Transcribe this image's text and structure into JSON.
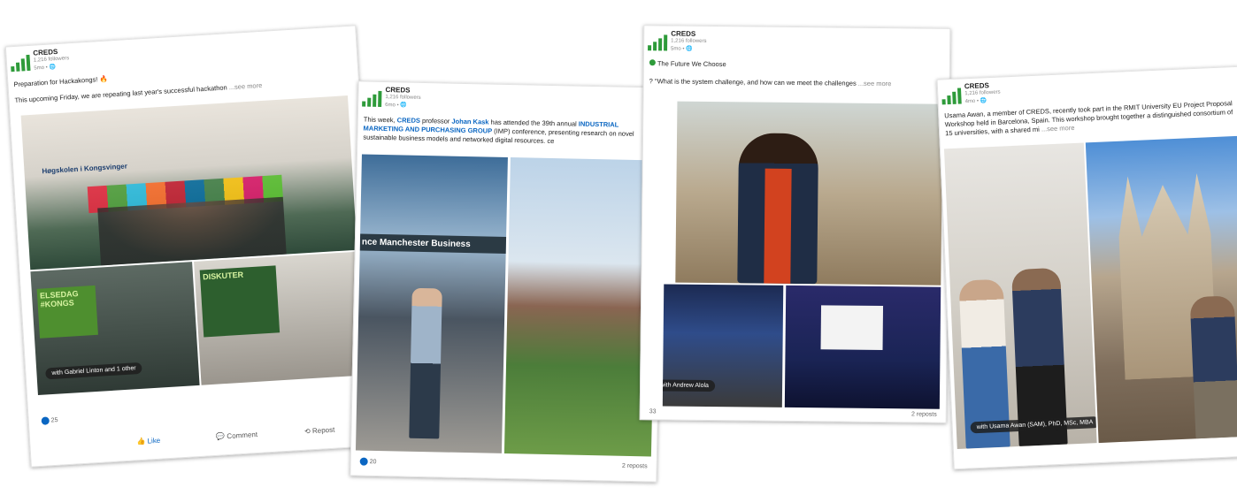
{
  "posts": [
    {
      "org": "CREDS",
      "followers": "1,216 followers",
      "age": "5mo • ",
      "line1": "Preparation for Hackakongs! 🔥",
      "line2": "This upcoming Friday, we are repeating last year's successful hackathon",
      "see_more": "...see more",
      "tag": "with Gabriel Linton and 1 other",
      "reactions": "25",
      "like": "Like",
      "comment": "Comment",
      "repost": "Repost",
      "sign_top": "Høgskolen i Kongsvinger",
      "screen1": "ELSEDAG #KONGS",
      "screen2": "DISKUTER"
    },
    {
      "org": "CREDS",
      "followers": "1,216 followers",
      "age": "6mo • ",
      "text_a": "This week, ",
      "text_b": "CREDS",
      "text_c": " professor ",
      "text_d": "Johan Kask",
      "text_e": " has attended the 39th annual ",
      "text_f": "INDUSTRIAL MARKETING AND PURCHASING GROUP",
      "text_g": " (IMP) conference, presenting research on novel sustainable business models and networked digital resources. ce",
      "sign": "nce Manchester Business",
      "reactions": "20",
      "reposts": "2 reposts"
    },
    {
      "org": "CREDS",
      "followers": "1,216 followers",
      "age": "5mo • ",
      "line1": "The Future We Choose",
      "line2": "? \"What is the system challenge, and how can we meet the challenges",
      "see_more": "...see more",
      "tag": "with Andrew Alola",
      "reactions": "33",
      "reposts": "2 reposts"
    },
    {
      "org": "CREDS",
      "followers": "1,216 followers",
      "age": "4mo • ",
      "text": "Usama Awan, a member of CREDS, recently took part in the RMIT University EU Project Proposal Workshop held in Barcelona, Spain. This workshop brought together a distinguished consortium of 15 universities, with a shared mi",
      "see_more": "...see more",
      "tag": "with Usama Awan (SAM), PhD, MSc, MBA"
    }
  ],
  "colors": {
    "brand_green": "#2e9b3a",
    "link_blue": "#0a66c2"
  }
}
